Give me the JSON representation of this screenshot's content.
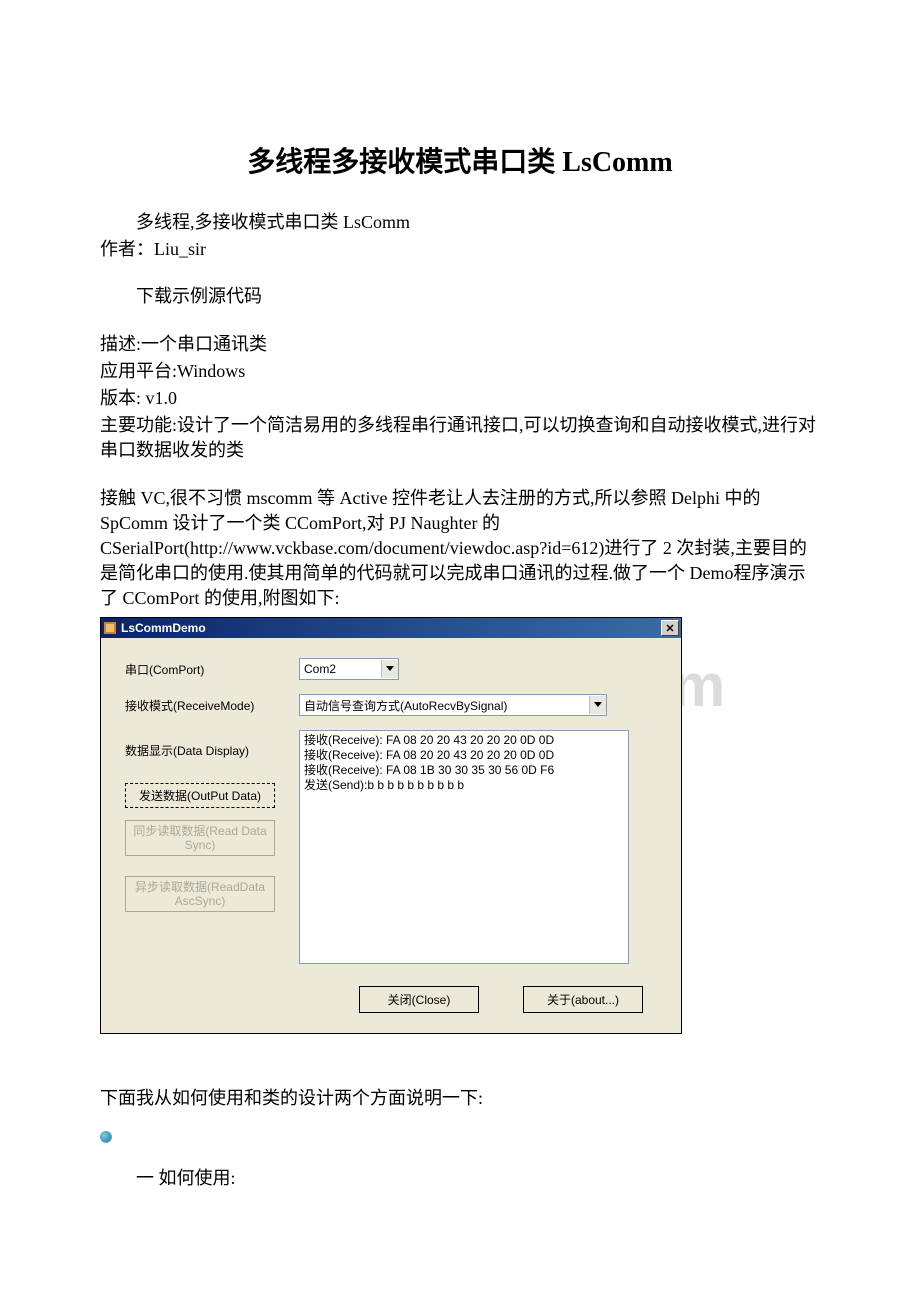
{
  "title": "多线程多接收模式串口类 LsComm",
  "line1": "多线程,多接收模式串口类 LsComm",
  "author": "作者：Liu_sir",
  "download": "下载示例源代码",
  "desc1": "描述:一个串口通讯类",
  "desc2": "应用平台:Windows",
  "desc3": "版本: v1.0",
  "desc4": "主要功能:设计了一个简洁易用的多线程串行通讯接口,可以切换查询和自动接收模式,进行对串口数据收发的类",
  "para2": "接触 VC,很不习惯 mscomm 等 Active 控件老让人去注册的方式,所以参照 Delphi 中的 SpComm 设计了一个类 CComPort,对 PJ Naughter 的CSerialPort(http://www.vckbase.com/document/viewdoc.asp?id=612)进行了 2 次封装,主要目的是简化串口的使用.使其用简单的代码就可以完成串口通讯的过程.做了一个 Demo程序演示了 CComPort 的使用,附图如下:",
  "watermark": "www.bdocx.com",
  "dialog": {
    "title": "LsCommDemo",
    "label_comport": "串口(ComPort)",
    "combo_comport": "Com2",
    "label_recvmode": "接收模式(ReceiveMode)",
    "combo_recvmode": "自动信号查询方式(AutoRecvBySignal)",
    "label_display": "数据显示(Data Display)",
    "list_lines": [
      "接收(Receive): FA 08 20 20 43 20 20 20 0D 0D",
      "接收(Receive): FA 08 20 20 43 20 20 20 0D 0D",
      "接收(Receive): FA 08 1B 30 30 35 30 56 0D F6",
      "发送(Send):b b b b b b b b b b"
    ],
    "btn_output": "发送数据(OutPut Data)",
    "btn_readsync": "同步读取数据(Read Data Sync)",
    "btn_readasync": "异步读取数据(ReadData AscSync)",
    "btn_close": "关闭(Close)",
    "btn_about": "关于(about...)"
  },
  "after1": "下面我从如何使用和类的设计两个方面说明一下:",
  "after2": "一 如何使用:"
}
